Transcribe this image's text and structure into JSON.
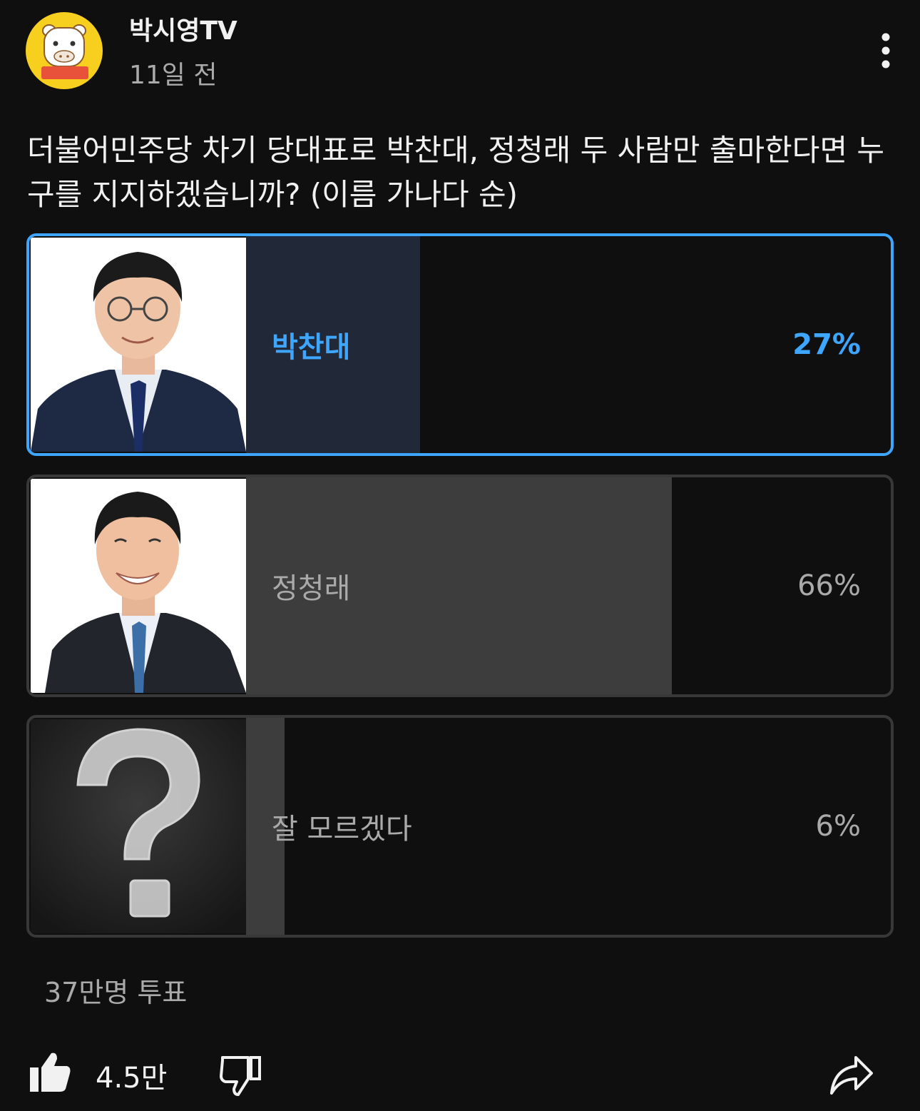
{
  "channel": {
    "name": "박시영TV",
    "time_ago": "11일 전",
    "avatar_label": "박시영TV"
  },
  "poll": {
    "question": "더불어민주당 차기 당대표로  박찬대, 정청래 두 사람만 출마한다면 누구를 지지하겠습니까? (이름 가나다 순)",
    "options": [
      {
        "label": "박찬대",
        "percent": "27%",
        "value": 27,
        "selected": true,
        "image": "candidate-photo"
      },
      {
        "label": "정청래",
        "percent": "66%",
        "value": 66,
        "selected": false,
        "image": "candidate-photo"
      },
      {
        "label": "잘 모르겠다",
        "percent": "6%",
        "value": 6,
        "selected": false,
        "image": "question-mark-chalk"
      }
    ],
    "total_votes": "37만명 투표"
  },
  "actions": {
    "like_count": "4.5만",
    "like_icon": "thumbs-up-filled-icon",
    "dislike_icon": "thumbs-down-outline-icon",
    "share_icon": "share-arrow-icon",
    "more_icon": "more-vertical-icon"
  },
  "colors": {
    "background": "#0f0f0f",
    "accent": "#3ea6ff",
    "selected_bar": "#212838",
    "bar": "#3d3d3d",
    "border": "#383838",
    "avatar": "#f7cf1f"
  }
}
